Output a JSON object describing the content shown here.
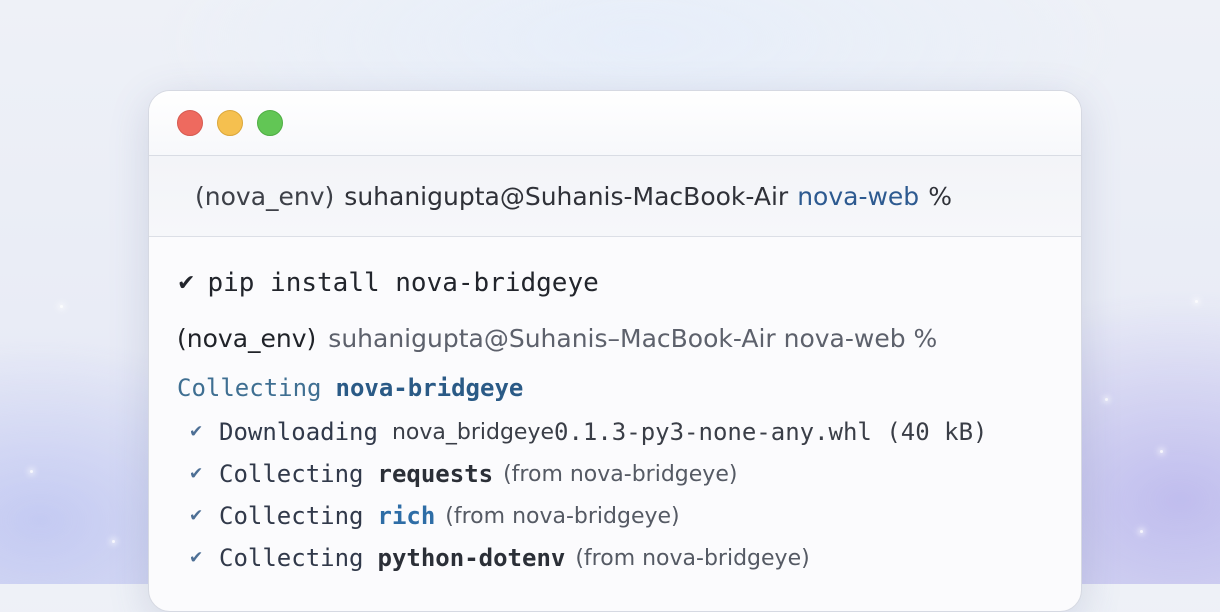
{
  "titlebar": {
    "lights": [
      "close",
      "minimize",
      "maximize"
    ]
  },
  "promptbar": {
    "env": "(nova_env)",
    "user_host": "suhanigupta@Suhanis-MacBook-Air",
    "dir": "nova-web",
    "symbol": "%"
  },
  "terminal": {
    "command": {
      "check": "✔",
      "text": "pip install nova-bridgeye"
    },
    "prompt": {
      "env": "(nova_env)",
      "rest": "suhanigupta@Suhanis–MacBook-Air nova-web %"
    },
    "collecting": {
      "keyword": "Collecting",
      "package": "nova-bridgeye"
    },
    "downloading": {
      "tick": "✔",
      "verb": "Downloading",
      "file": "nova_bridgeye",
      "rest": "0.1.3-py3-none-any.whl (40 kB)"
    },
    "deps": [
      {
        "tick": "✔",
        "verb": "Collecting",
        "package": "requests",
        "from": "(from nova-bridgeye)"
      },
      {
        "tick": "✔",
        "verb": "Collecting",
        "package": "rich",
        "from": "(from nova-bridgeye)"
      },
      {
        "tick": "✔",
        "verb": "Collecting",
        "package": "python-dotenv",
        "from": "(from nova-bridgeye)"
      }
    ]
  },
  "colors": {
    "accent_blue": "#2e6da6",
    "dir_blue": "#2d5a90",
    "light_red": "#ee6a5f",
    "light_yellow": "#f5c04f",
    "light_green": "#62c655"
  }
}
